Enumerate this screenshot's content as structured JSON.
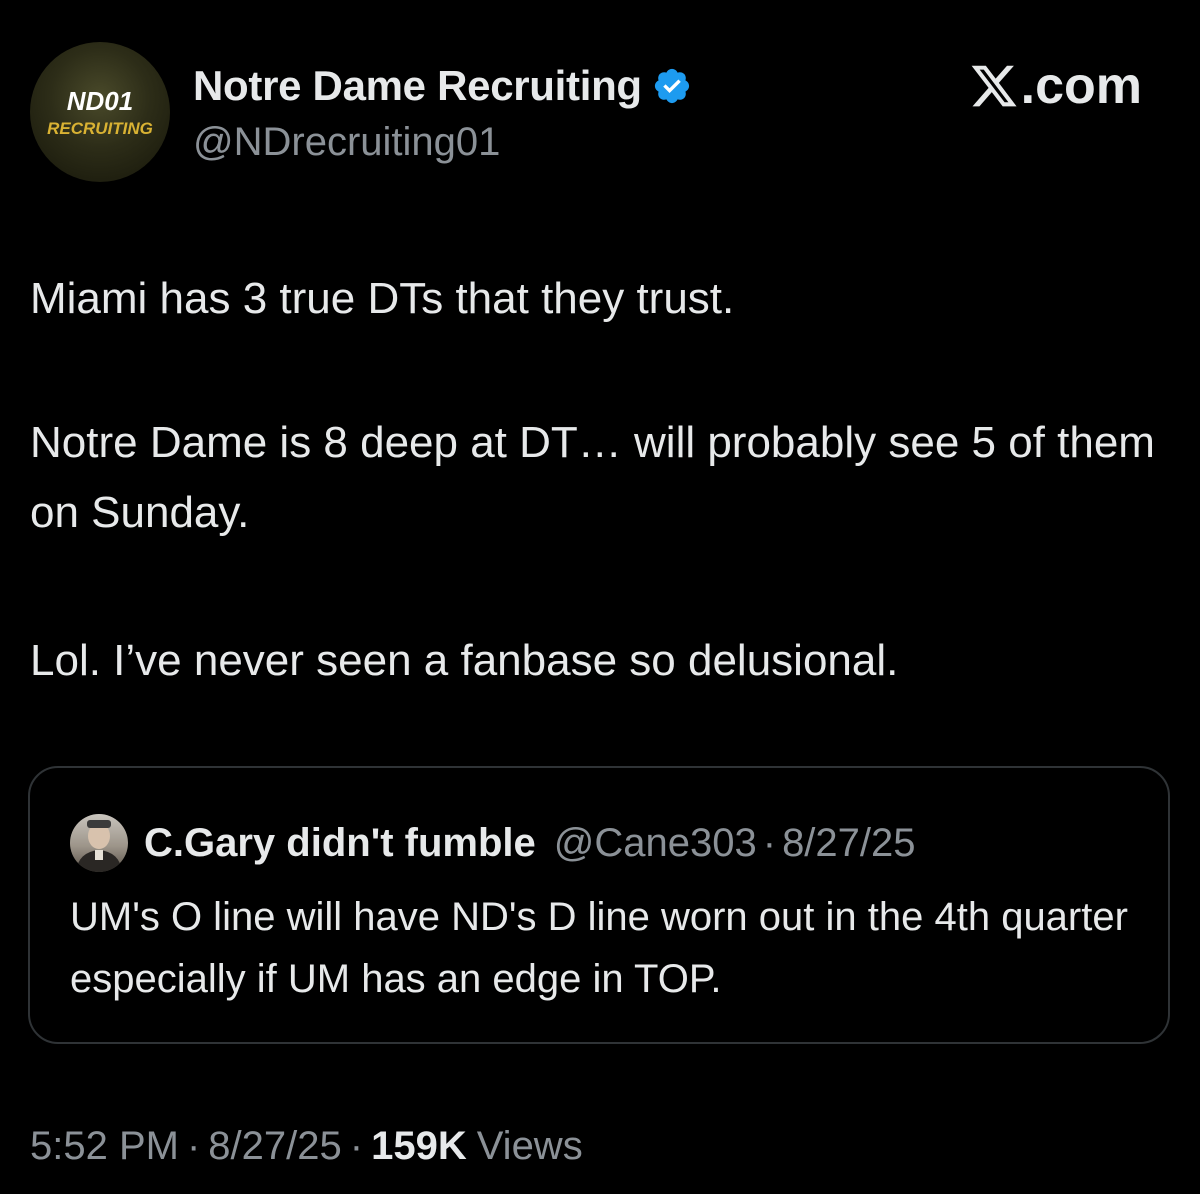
{
  "author": {
    "display_name": "Notre Dame Recruiting",
    "handle": "@NDrecruiting01",
    "avatar_text_top": "ND01",
    "avatar_text_bottom": "RECRUITING",
    "verified_icon": "verified-badge-icon",
    "verified_color": "#1d9bf0"
  },
  "source": {
    "site_label": ".com",
    "logo_icon": "x-logo-icon"
  },
  "tweet": {
    "paragraphs": [
      "Miami has 3 true DTs that they trust.",
      "Notre Dame is 8 deep at DT… will probably see 5 of them on Sunday.",
      "Lol. I’ve never seen a fanbase so delusional."
    ]
  },
  "quoted_tweet": {
    "display_name": "C.Gary didn't fumble",
    "handle": "@Cane303",
    "separator": "·",
    "date": "8/27/25",
    "text": "UM's O line will have ND's D line worn out in the 4th quarter especially if UM has an edge in TOP."
  },
  "meta": {
    "time": "5:52 PM",
    "separator": "·",
    "date": "8/27/25",
    "views_count": "159K",
    "views_label": "Views"
  },
  "colors": {
    "background": "#000000",
    "primary_text": "#e7e9ea",
    "secondary_text": "#8b9197",
    "border": "#2f3336"
  }
}
